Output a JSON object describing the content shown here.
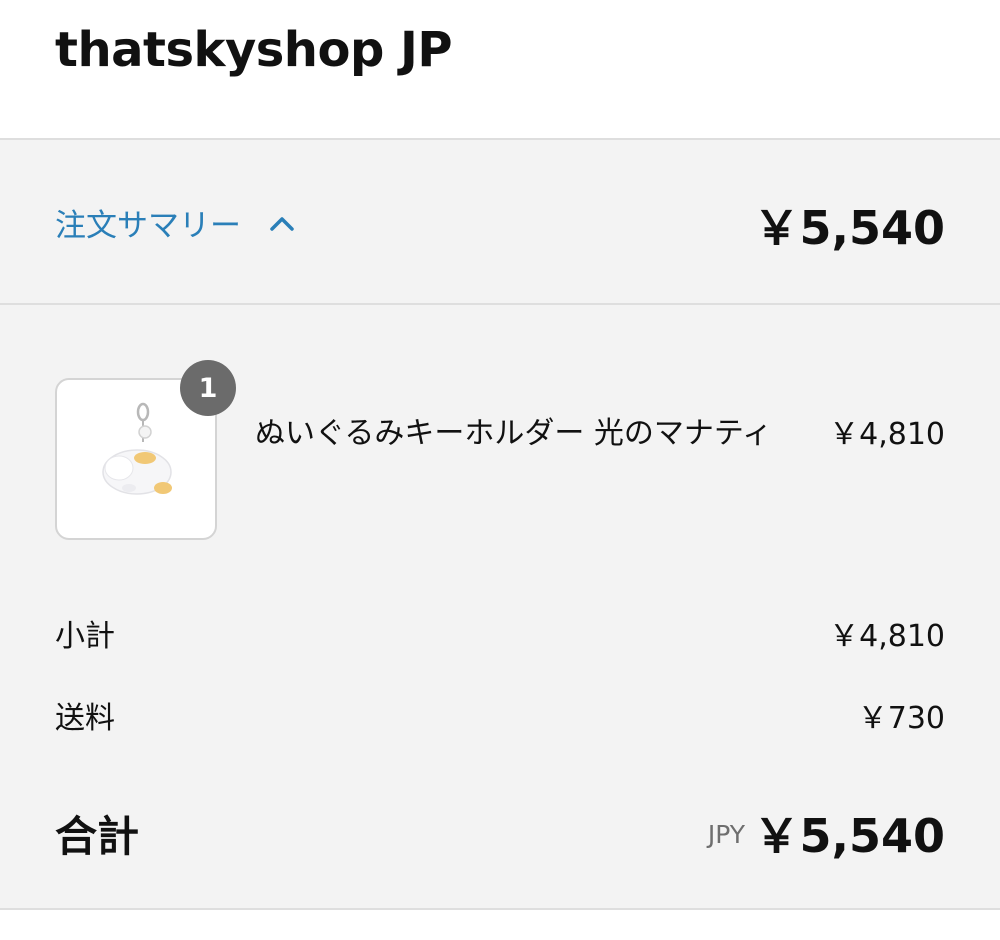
{
  "header": {
    "shop_title": "thatskyshop JP"
  },
  "summary": {
    "toggle_label": "注文サマリー",
    "toggle_icon": "chevron-up-icon",
    "total": "￥5,540"
  },
  "line_items": [
    {
      "quantity": "1",
      "name": "ぬいぐるみキーホルダー 光のマナティ",
      "price": "￥4,810",
      "image": "plush-keychain-manatee"
    }
  ],
  "totals": {
    "subtotal_label": "小計",
    "subtotal_value": "￥4,810",
    "shipping_label": "送料",
    "shipping_value": "￥730",
    "total_label": "合計",
    "total_currency": "JPY",
    "total_value": "￥5,540"
  },
  "colors": {
    "link": "#2a7fb8",
    "panel_bg": "#f3f3f3",
    "badge_bg": "#6b6b6b"
  }
}
